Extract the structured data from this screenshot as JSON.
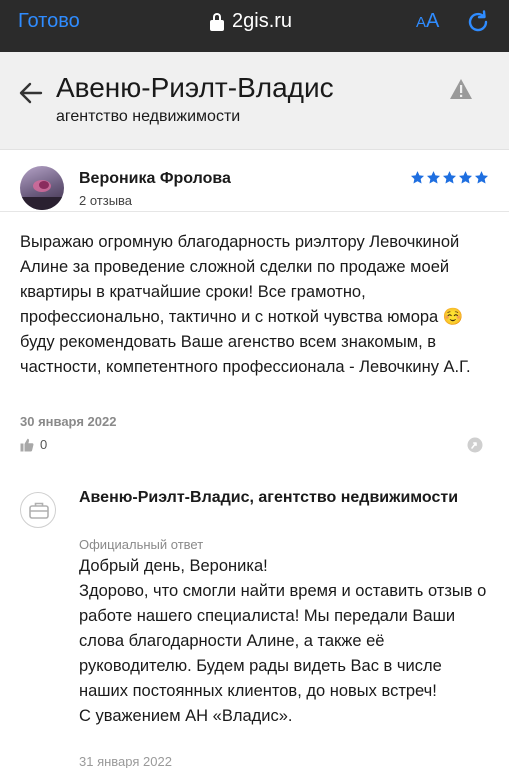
{
  "browser": {
    "done_label": "Готово",
    "url": "2gis.ru",
    "text_size_small": "A",
    "text_size_large": "A"
  },
  "header": {
    "title": "Авеню-Риэлт-Владис",
    "subtitle": "агентство недвижимости"
  },
  "review": {
    "author": "Вероника Фролова",
    "author_reviews": "2 отзыва",
    "rating": 5,
    "text": "Выражаю огромную благодарность риэлтору Левочкиной Алине за проведение сложной сделки по продаже моей квартиры в кратчайшие сроки! Все грамотно, профессионально, тактично и с ноткой чувства юмора ☺️ буду рекомендовать Ваше агенство всем знакомым, в частности, компетентного профессионала - Левочкину А.Г.",
    "date": "30 января 2022",
    "likes": "0"
  },
  "reply": {
    "author": "Авеню-Риэлт-Владис, агентство недвижимости",
    "label": "Официальный ответ",
    "text": "Добрый день, Вероника!\nЗдорово, что смогли найти время и оставить отзыв о работе нашего специалиста! Мы передали Ваши слова благодарности Алине, а также её руководителю. Будем рады видеть Вас в числе наших постоянных клиентов, до новых встреч!\nС уважением АН «Владис».",
    "date": "31 января 2022"
  },
  "colors": {
    "accent_blue": "#2f8cff",
    "star_blue": "#1f6fe0",
    "browser_bar": "#2b2b2b",
    "header_bg": "#f0f0f0"
  },
  "icons": [
    "lock-icon",
    "reload-icon",
    "back-arrow-icon",
    "warning-icon",
    "star-icon",
    "thumbs-up-icon",
    "share-icon",
    "briefcase-icon"
  ]
}
